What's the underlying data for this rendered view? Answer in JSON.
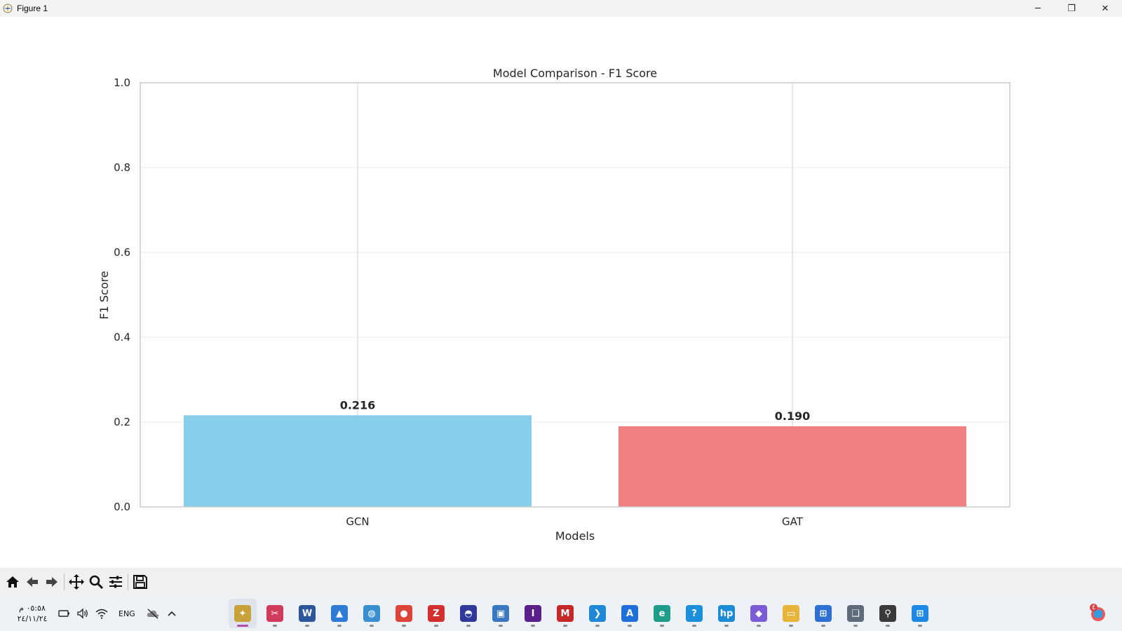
{
  "window": {
    "title": "Figure 1",
    "minimize_glyph": "─",
    "maximize_glyph": "❐",
    "close_glyph": "✕"
  },
  "chart_data": {
    "type": "bar",
    "title": "Model Comparison - F1 Score",
    "xlabel": "Models",
    "ylabel": "F1 Score",
    "categories": [
      "GCN",
      "GAT"
    ],
    "values": [
      0.216,
      0.19
    ],
    "value_labels": [
      "0.216",
      "0.190"
    ],
    "colors": [
      "#87ceeb",
      "#f08080"
    ],
    "ylim": [
      0,
      1.0
    ],
    "yticks": [
      0.0,
      0.2,
      0.4,
      0.6,
      0.8,
      1.0
    ],
    "ytick_labels": [
      "0.0",
      "0.2",
      "0.4",
      "0.6",
      "0.8",
      "1.0"
    ],
    "grid": true,
    "legend": "none"
  },
  "toolbar": {
    "buttons": [
      "home-icon",
      "back-icon",
      "forward-icon",
      "pan-icon",
      "zoom-icon",
      "configure-icon",
      "save-icon"
    ]
  },
  "taskbar": {
    "clock_time": "٠٥:٥٨ م",
    "clock_date": "٢٤/١١/٢٤",
    "language": "ENG",
    "notification_count": "٤",
    "apps": [
      {
        "name": "python-figure",
        "letter": "✦",
        "color": "#c8a13a",
        "active": true
      },
      {
        "name": "snipping-tool",
        "letter": "✂",
        "color": "#d13a5a",
        "active": false
      },
      {
        "name": "word",
        "letter": "W",
        "color": "#2b579a",
        "active": false
      },
      {
        "name": "photos",
        "letter": "▲",
        "color": "#2e7bd6",
        "active": false
      },
      {
        "name": "browser-globe",
        "letter": "◍",
        "color": "#3a8fd0",
        "active": false
      },
      {
        "name": "chrome",
        "letter": "●",
        "color": "#db4437",
        "active": false
      },
      {
        "name": "zotero",
        "letter": "Z",
        "color": "#d32f2f",
        "active": false
      },
      {
        "name": "vpn",
        "letter": "◓",
        "color": "#2f3a9c",
        "active": false
      },
      {
        "name": "python-idle",
        "letter": "▣",
        "color": "#3b78c2",
        "active": false
      },
      {
        "name": "intellij",
        "letter": "I",
        "color": "#5a1f8c",
        "active": false
      },
      {
        "name": "mcafee",
        "letter": "M",
        "color": "#c62828",
        "active": false
      },
      {
        "name": "vscode",
        "letter": "❯",
        "color": "#1f88d8",
        "active": false
      },
      {
        "name": "app-store",
        "letter": "A",
        "color": "#1e6fd9",
        "active": false
      },
      {
        "name": "edge",
        "letter": "e",
        "color": "#1f9d8b",
        "active": false
      },
      {
        "name": "help",
        "letter": "?",
        "color": "#1a8fdc",
        "active": false
      },
      {
        "name": "myhp",
        "letter": "hp",
        "color": "#1c8cd8",
        "active": false
      },
      {
        "name": "copilot",
        "letter": "◆",
        "color": "#7b5bd6",
        "active": false
      },
      {
        "name": "file-explorer",
        "letter": "▭",
        "color": "#e8b43c",
        "active": false
      },
      {
        "name": "microsoft-store",
        "letter": "⊞",
        "color": "#2d6fd2",
        "active": false
      },
      {
        "name": "task-view",
        "letter": "❑",
        "color": "#5f6b7a",
        "active": false
      },
      {
        "name": "search",
        "letter": "⚲",
        "color": "#3a3a3a",
        "active": false
      },
      {
        "name": "start",
        "letter": "⊞",
        "color": "#1e88e5",
        "active": false
      }
    ]
  }
}
